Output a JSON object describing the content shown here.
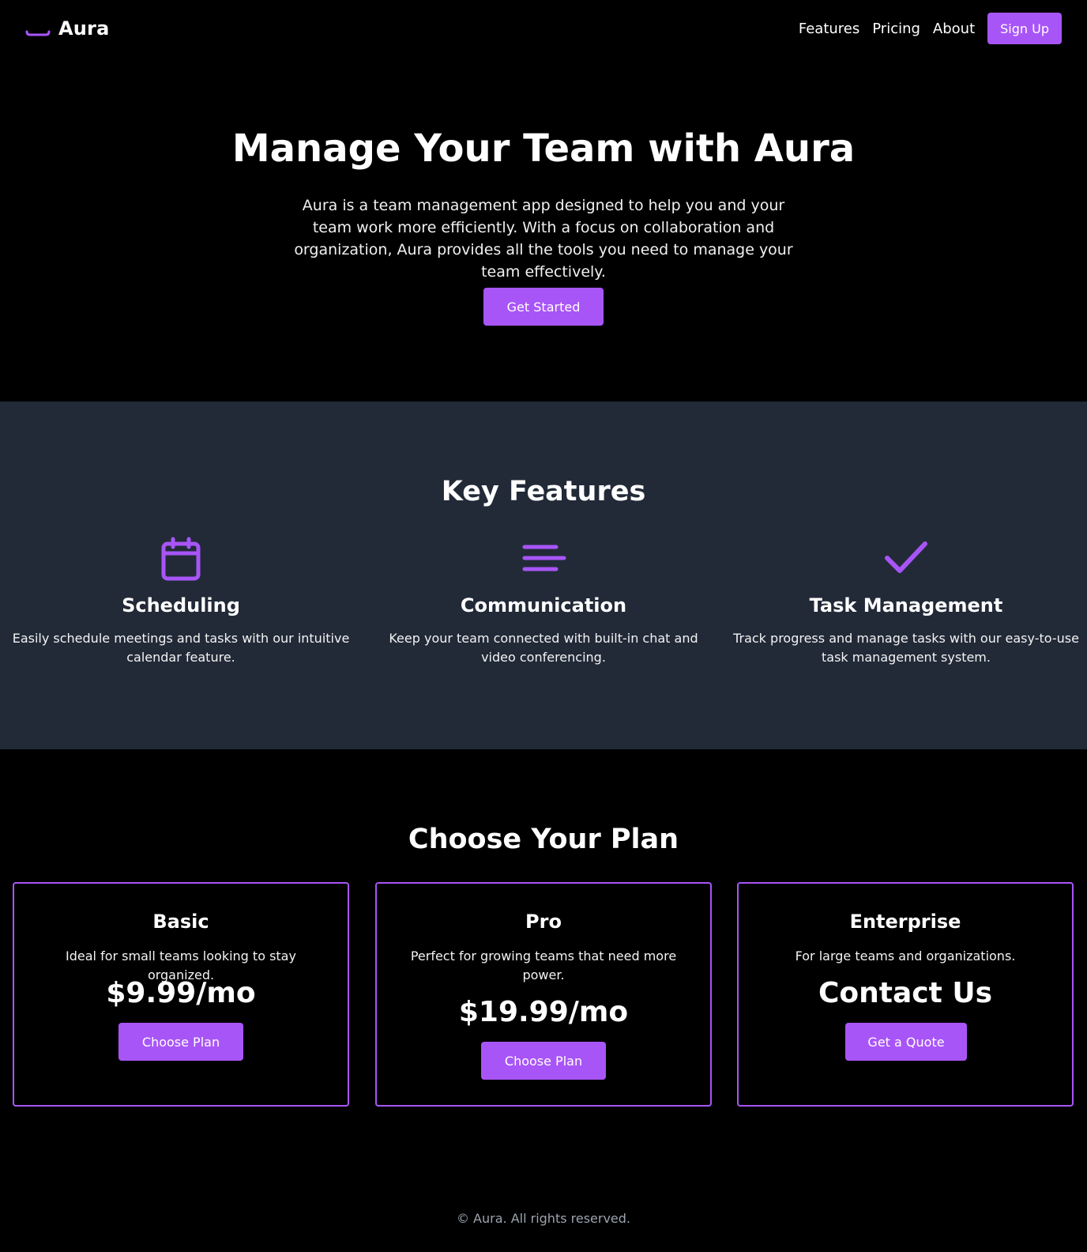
{
  "colors": {
    "accent": "#a855f7",
    "background": "#000000",
    "features_bg": "#222a38",
    "footer_text": "#9ca3af"
  },
  "header": {
    "brand": {
      "logo_icon": "underline-bar-icon",
      "name": "Aura"
    },
    "nav": [
      {
        "label": "Features"
      },
      {
        "label": "Pricing"
      },
      {
        "label": "About"
      }
    ],
    "signup_label": "Sign Up"
  },
  "hero": {
    "title": "Manage Your Team with Aura",
    "description": "Aura is a team management app designed to help you and your team work more efficiently. With a focus on collaboration and organization, Aura provides all the tools you need to manage your team effectively.",
    "cta_label": "Get Started"
  },
  "features": {
    "title": "Key Features",
    "items": [
      {
        "icon": "calendar-icon",
        "title": "Scheduling",
        "description": "Easily schedule meetings and tasks with our intuitive calendar feature."
      },
      {
        "icon": "lines-icon",
        "title": "Communication",
        "description": "Keep your team connected with built-in chat and video conferencing."
      },
      {
        "icon": "checkmark-icon",
        "title": "Task Management",
        "description": "Track progress and manage tasks with our easy-to-use task management system."
      }
    ]
  },
  "pricing": {
    "title": "Choose Your Plan",
    "plans": [
      {
        "name": "Basic",
        "description": "Ideal for small teams looking to stay organized.",
        "price": "$9.99/mo",
        "button": "Choose Plan"
      },
      {
        "name": "Pro",
        "description": "Perfect for growing teams that need more power.",
        "price": "$19.99/mo",
        "button": "Choose Plan"
      },
      {
        "name": "Enterprise",
        "description": "For large teams and organizations.",
        "price": "Contact Us",
        "button": "Get a Quote"
      }
    ]
  },
  "footer": {
    "text": "© Aura. All rights reserved."
  }
}
